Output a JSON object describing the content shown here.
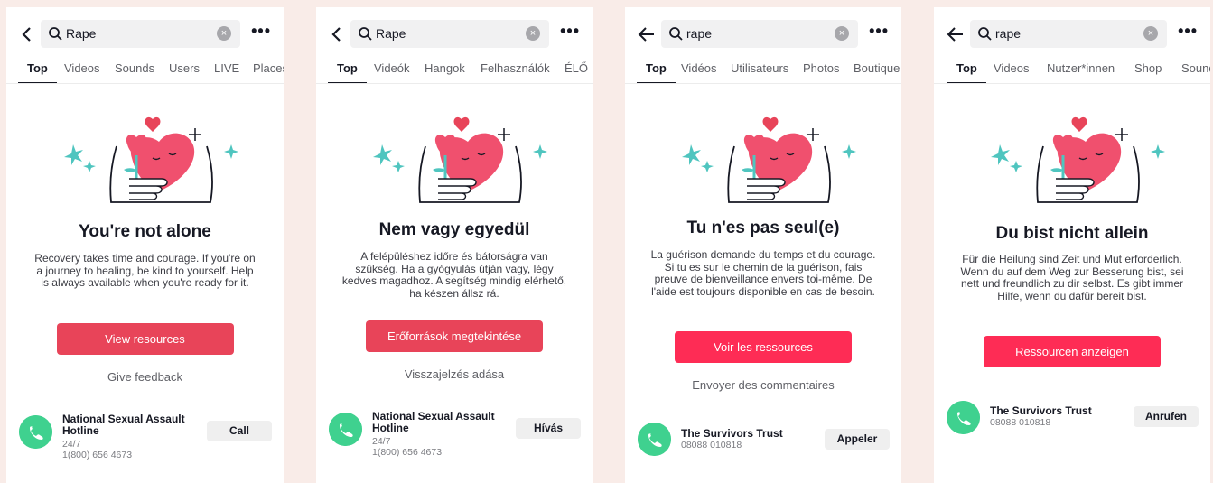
{
  "colors": {
    "cta_dark": "#e84459",
    "cta_bright": "#fe2c55",
    "phone": "#3fd18f"
  },
  "panels": [
    {
      "search_query": "Rape",
      "tabs": [
        "Top",
        "Videos",
        "Sounds",
        "Users",
        "LIVE",
        "Places"
      ],
      "title": "You're not alone",
      "description": "Recovery takes time and courage. If you're on a journey to healing, be kind to yourself. Help is always available when you're ready for it.",
      "cta": "View resources",
      "feedback": "Give feedback",
      "hotline_name": "National Sexual Assault Hotline",
      "hotline_hours": "24/7",
      "hotline_number": "1(800) 656 4673",
      "call": "Call"
    },
    {
      "search_query": "Rape",
      "tabs": [
        "Top",
        "Videók",
        "Hangok",
        "Felhasználók",
        "ÉLŐ"
      ],
      "title": "Nem vagy egyedül",
      "description": "A felépüléshez időre és bátorságra van szükség. Ha a gyógyulás útján vagy, légy kedves magadhoz. A segítség mindig elérhető, ha készen állsz rá.",
      "cta": "Erőforrások megtekintése",
      "feedback": "Visszajelzés adása",
      "hotline_name": "National Sexual Assault Hotline",
      "hotline_hours": "24/7",
      "hotline_number": "1(800) 656 4673",
      "call": "Hívás"
    },
    {
      "search_query": "rape",
      "tabs": [
        "Top",
        "Vidéos",
        "Utilisateurs",
        "Photos",
        "Boutique"
      ],
      "title": "Tu n'es pas seul(e)",
      "description": "La guérison demande du temps et du courage. Si tu es sur le chemin de la guérison, fais preuve de bienveillance envers toi-même. De l'aide est toujours disponible en cas de besoin.",
      "cta": "Voir les ressources",
      "feedback": "Envoyer des commentaires",
      "hotline_name": "The Survivors Trust",
      "hotline_number": "08088 010818",
      "call": "Appeler"
    },
    {
      "search_query": "rape",
      "tabs": [
        "Top",
        "Videos",
        "Nutzer*innen",
        "Shop",
        "Sounds"
      ],
      "title": "Du bist nicht allein",
      "description": "Für die Heilung sind Zeit und Mut erforderlich. Wenn du auf dem Weg zur Besserung bist, sei nett und freundlich zu dir selbst. Es gibt immer Hilfe, wenn du dafür bereit bist.",
      "cta": "Ressourcen anzeigen",
      "hotline_name": "The Survivors Trust",
      "hotline_number": "08088 010818",
      "call": "Anrufen"
    }
  ]
}
